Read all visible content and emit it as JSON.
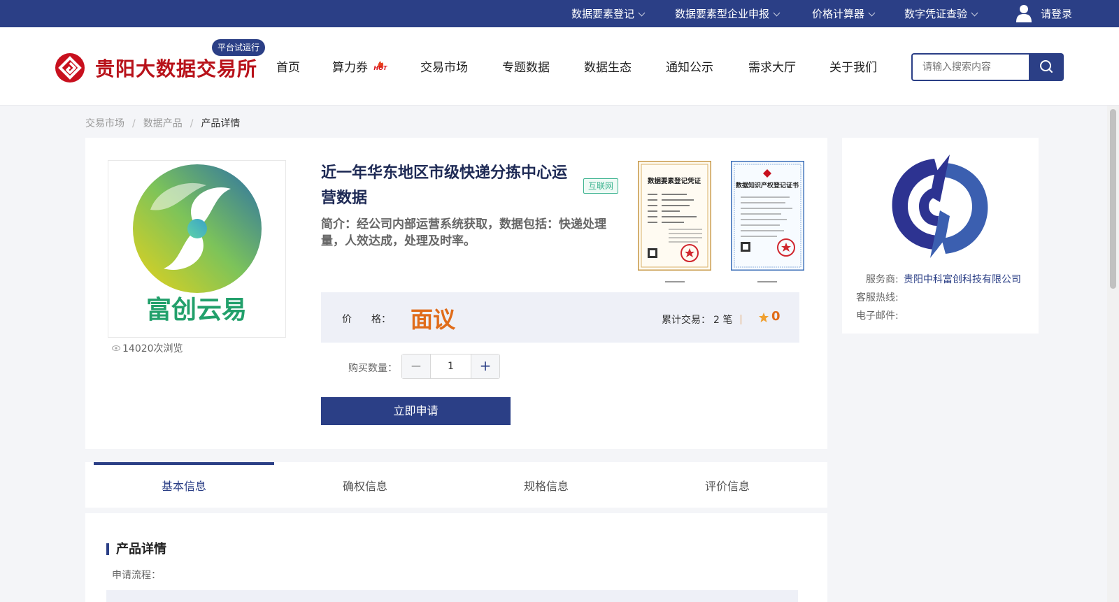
{
  "topbar": {
    "items": [
      {
        "label": "数据要素登记"
      },
      {
        "label": "数据要素型企业申报"
      },
      {
        "label": "价格计算器"
      },
      {
        "label": "数字凭证查验"
      }
    ],
    "login_label": "请登录"
  },
  "header": {
    "logo_text": "贵阳大数据交易所",
    "trial_badge": "平台试运行",
    "nav": [
      "首页",
      "算力券",
      "交易市场",
      "专题数据",
      "数据生态",
      "通知公示",
      "需求大厅",
      "关于我们"
    ],
    "hot_label": "HOT",
    "search_placeholder": "请输入搜索内容"
  },
  "breadcrumb": {
    "items": [
      "交易市场",
      "数据产品",
      "产品详情"
    ],
    "separator": "/"
  },
  "product": {
    "logo_caption": "富创云易",
    "views": "14020次浏览",
    "title": "近一年华东地区市级快递分拣中心运营数据",
    "tag": "互联网",
    "intro": "简介：经公司内部运营系统获取，数据包括：快递处理量，人效达成，处理及时率。",
    "certificates": [
      {
        "title": "数据要素登记凭证"
      },
      {
        "title": "数据知识产权登记证书"
      }
    ],
    "price_label": "价　　格：",
    "price_value": "面议",
    "trades_label": "累计交易：",
    "trades_value": "2 笔",
    "rating_value": "0",
    "quantity_label": "购买数量：",
    "quantity_value": "1",
    "minus_symbol": "−",
    "plus_symbol": "+",
    "apply_label": "立即申请"
  },
  "provider": {
    "service_label": "服务商:",
    "service_value": "贵阳中科富创科技有限公司",
    "hotline_label": "客服热线:",
    "email_label": "电子邮件:"
  },
  "tabs": [
    "基本信息",
    "确权信息",
    "规格信息",
    "评价信息"
  ],
  "detail": {
    "section_title": "产品详情",
    "apply_process_label": "申请流程："
  },
  "colors": {
    "brand": "#2b3f86",
    "logo_red": "#c8101e",
    "price_orange": "#e06c1a",
    "tag_green": "#3bb38f"
  }
}
